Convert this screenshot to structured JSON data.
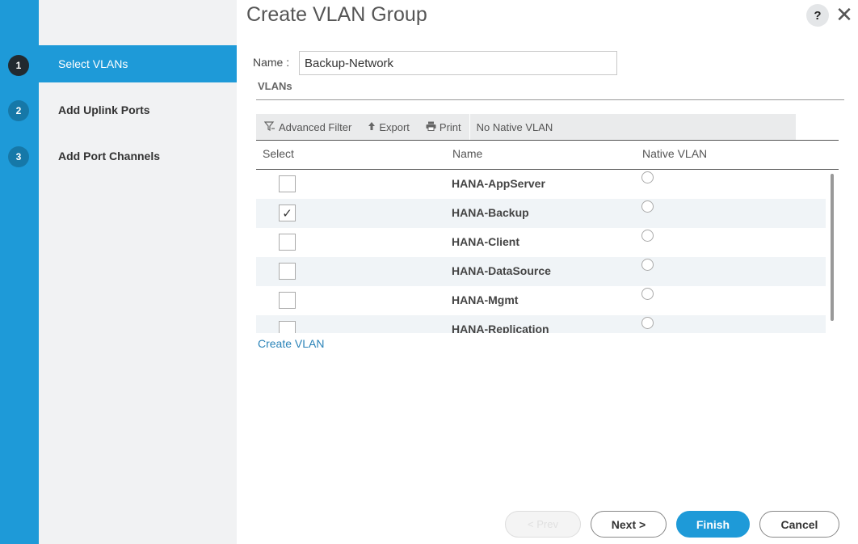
{
  "dialog": {
    "title": "Create VLAN Group",
    "help_label": "?",
    "close_label": "✕"
  },
  "steps": [
    {
      "num": "1",
      "label": "Select VLANs",
      "active": true
    },
    {
      "num": "2",
      "label": "Add Uplink Ports",
      "active": false
    },
    {
      "num": "3",
      "label": "Add Port Channels",
      "active": false
    }
  ],
  "form": {
    "name_label": "Name :",
    "name_value": "Backup-Network",
    "vlans_section": "VLANs"
  },
  "toolbar": {
    "advanced_filter": "Advanced Filter",
    "export": "Export",
    "print": "Print",
    "native_vlan": "No Native VLAN"
  },
  "table": {
    "headers": [
      "Select",
      "Name",
      "Native VLAN"
    ],
    "rows": [
      {
        "name": "HANA-AppServer",
        "checked": false,
        "check_mark": ""
      },
      {
        "name": "HANA-Backup",
        "checked": true,
        "check_mark": "✓"
      },
      {
        "name": "HANA-Client",
        "checked": false,
        "check_mark": ""
      },
      {
        "name": "HANA-DataSource",
        "checked": false,
        "check_mark": ""
      },
      {
        "name": "HANA-Mgmt",
        "checked": false,
        "check_mark": ""
      },
      {
        "name": "HANA-Replication",
        "checked": false,
        "check_mark": ""
      }
    ]
  },
  "links": {
    "create_vlan": "Create VLAN"
  },
  "footer": {
    "prev": "< Prev",
    "next": "Next >",
    "finish": "Finish",
    "cancel": "Cancel"
  },
  "colors": {
    "accent": "#1e9ad8",
    "active_step_badge": "#222a30"
  }
}
